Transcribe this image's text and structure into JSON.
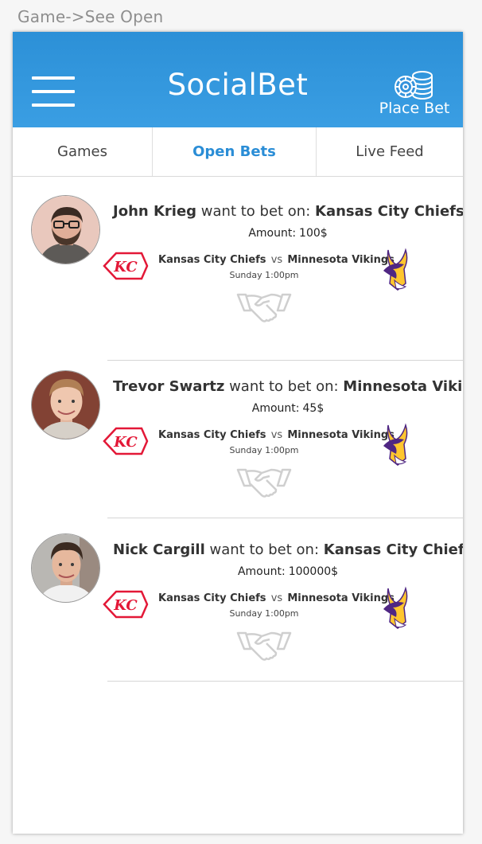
{
  "caption": "Game->See Open",
  "header": {
    "title": "SocialBet",
    "place_bet_label": "Place Bet",
    "menu_icon": "hamburger-menu-icon",
    "chips_icon": "poker-chips-icon",
    "background_color": "#3493dc"
  },
  "tabs": [
    {
      "label": "Games",
      "active": false
    },
    {
      "label": "Open Bets",
      "active": true
    },
    {
      "label": "Live Feed",
      "active": false
    }
  ],
  "labels": {
    "want_to_bet": "want to bet on:",
    "amount": "Amount:",
    "vs": "vs"
  },
  "bets": [
    {
      "user": "John Krieg",
      "team": "Kansas City Chiefs",
      "amount": "100$",
      "home": "Kansas City Chiefs",
      "away": "Minnesota Vikings",
      "time": "Sunday 1:00pm"
    },
    {
      "user": "Trevor Swartz",
      "team": "Minnesota Vikings",
      "amount": "45$",
      "home": "Kansas City Chiefs",
      "away": "Minnesota Vikings",
      "time": "Sunday 1:00pm"
    },
    {
      "user": "Nick Cargill",
      "team": "Kansas City Chiefs",
      "amount": "100000$",
      "home": "Kansas City Chiefs",
      "away": "Minnesota Vikings",
      "time": "Sunday 1:00pm"
    }
  ],
  "colors": {
    "accent": "#2a8dd6",
    "chiefs_red": "#e31837",
    "vikings_purple": "#4f2683",
    "vikings_gold": "#ffc62f"
  }
}
